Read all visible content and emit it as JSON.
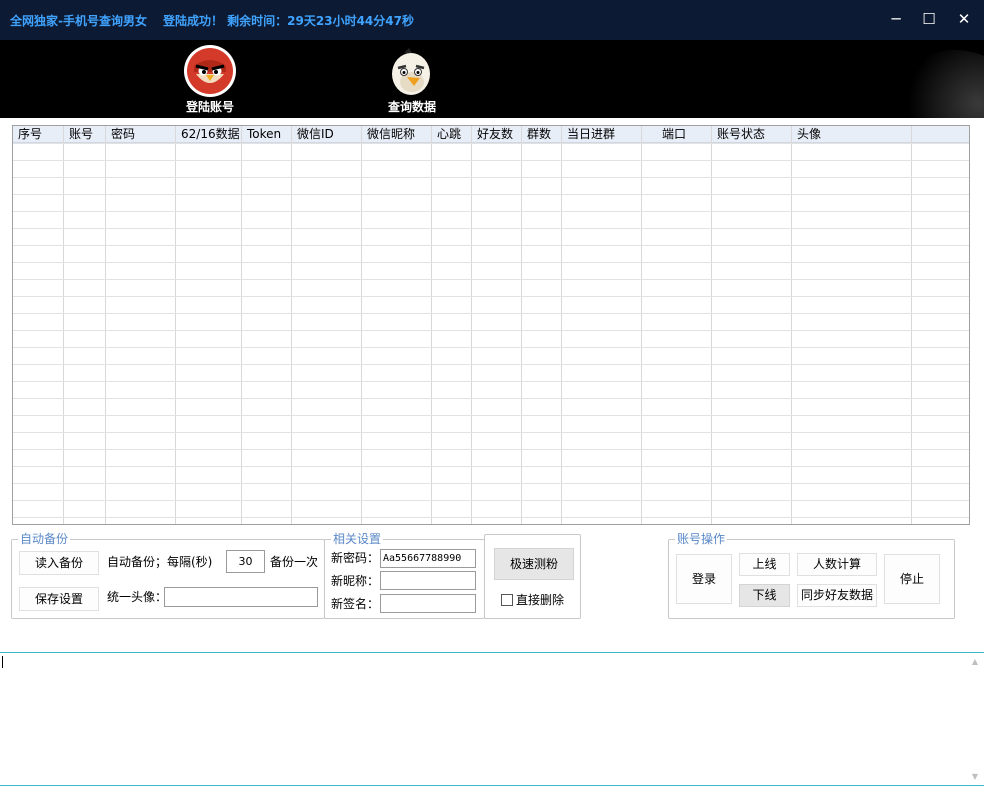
{
  "window": {
    "title": "全网独家-手机号查询男女",
    "status": "登陆成功！ 剩余时间：29天23小时44分47秒",
    "minimize_glyph": "─",
    "maximize_glyph": "☐",
    "close_glyph": "✕"
  },
  "nav": {
    "items": [
      {
        "label": "登陆账号",
        "icon": "red-bird-icon"
      },
      {
        "label": "查询数据",
        "icon": "white-bird-icon"
      }
    ]
  },
  "table": {
    "columns": [
      "序号",
      "账号",
      "密码",
      "62/16数据",
      "Token",
      "微信ID",
      "微信昵称",
      "心跳",
      "好友数",
      "群数",
      "当日进群",
      "端口",
      "账号状态",
      "头像"
    ],
    "rows": []
  },
  "backup": {
    "title": "自动备份",
    "load_button": "读入备份",
    "save_button": "保存设置",
    "interval_label": "自动备份；每隔(秒)",
    "interval_value": "30",
    "interval_suffix": "备份一次",
    "avatar_label": "统一头像：",
    "avatar_value": ""
  },
  "settings": {
    "title": "相关设置",
    "password_label": "新密码：",
    "password_value": "Aa55667788990",
    "nickname_label": "新昵称：",
    "nickname_value": "",
    "signature_label": "新签名：",
    "signature_value": ""
  },
  "fast": {
    "button": "极速测粉",
    "delete_label": "直接删除"
  },
  "account_ops": {
    "title": "账号操作",
    "login": "登录",
    "online": "上线",
    "offline": "下线",
    "count": "人数计算",
    "sync": "同步好友数据",
    "stop": "停止"
  },
  "colors": {
    "titlebar": "#0d1a33",
    "title_text": "#3fa3ff",
    "group_title": "#5a88c8",
    "log_border": "#3cb7c4"
  }
}
